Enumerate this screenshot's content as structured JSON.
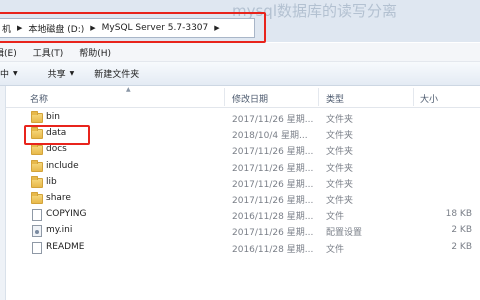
{
  "watermark": "mysql数据库的读写分离",
  "breadcrumb": {
    "items": [
      "机",
      "本地磁盘 (D:)",
      "MySQL Server 5.7-3307"
    ],
    "separator": "▶"
  },
  "menu": {
    "items": [
      "编辑(E)",
      "工具(T)",
      "帮助(H)"
    ]
  },
  "toolbar": {
    "share_label": "共享",
    "new_folder_label": "新建文件夹",
    "leading_fragment": "中"
  },
  "columns": {
    "name": "名称",
    "date": "修改日期",
    "type": "类型",
    "size": "大小"
  },
  "files": [
    {
      "name": "bin",
      "date": "2017/11/26 星期...",
      "type": "文件夹",
      "size": "",
      "icon": "folder-icon"
    },
    {
      "name": "data",
      "date": "2018/10/4 星期...",
      "type": "文件夹",
      "size": "",
      "icon": "folder-icon"
    },
    {
      "name": "docs",
      "date": "2017/11/26 星期...",
      "type": "文件夹",
      "size": "",
      "icon": "folder-icon"
    },
    {
      "name": "include",
      "date": "2017/11/26 星期...",
      "type": "文件夹",
      "size": "",
      "icon": "folder-icon"
    },
    {
      "name": "lib",
      "date": "2017/11/26 星期...",
      "type": "文件夹",
      "size": "",
      "icon": "folder-icon"
    },
    {
      "name": "share",
      "date": "2017/11/26 星期...",
      "type": "文件夹",
      "size": "",
      "icon": "folder-icon"
    },
    {
      "name": "COPYING",
      "date": "2016/11/28 星期...",
      "type": "文件",
      "size": "18 KB",
      "icon": "file-icon"
    },
    {
      "name": "my.ini",
      "date": "2017/11/26 星期...",
      "type": "配置设置",
      "size": "2 KB",
      "icon": "settings-file-icon"
    },
    {
      "name": "README",
      "date": "2016/11/28 星期...",
      "type": "文件",
      "size": "2 KB",
      "icon": "file-icon"
    }
  ],
  "colors": {
    "highlight_box": "#e8241c",
    "toolbar_bg": "#e4ebf4",
    "folder": "#e7b94b"
  }
}
